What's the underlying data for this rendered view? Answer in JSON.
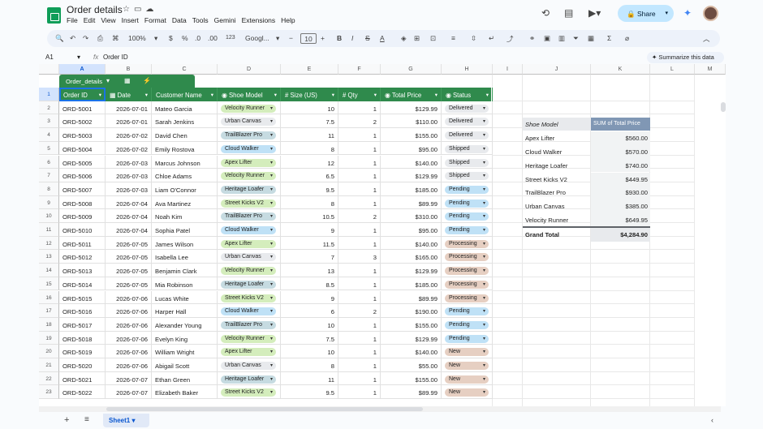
{
  "app": {
    "title": "Order details",
    "menu": [
      "File",
      "Edit",
      "View",
      "Insert",
      "Format",
      "Data",
      "Tools",
      "Gemini",
      "Extensions",
      "Help"
    ],
    "share_label": "Share"
  },
  "toolbar": {
    "zoom": "100%",
    "currency": "$",
    "percent": "%",
    "dec_decrease": ".0",
    "dec_increase": ".00",
    "number_format": "123",
    "font": "Googl...",
    "font_size": "10"
  },
  "formula_bar": {
    "name_box": "A1",
    "fx": "fx",
    "value": "Order ID",
    "summarize": "Summarize this data"
  },
  "columns": [
    "A",
    "B",
    "C",
    "D",
    "E",
    "F",
    "G",
    "H",
    "I",
    "J",
    "K",
    "L",
    "M"
  ],
  "table": {
    "name": "Order_details",
    "headers": [
      "Order ID",
      "Date",
      "Customer Name",
      "Shoe Model",
      "Size (US)",
      "Qty",
      "Total Price",
      "Status"
    ],
    "rows": [
      [
        "ORD-5001",
        "2026-07-01",
        "Mateo Garcia",
        "Velocity Runner",
        "10",
        "1",
        "$129.99",
        "Delivered"
      ],
      [
        "ORD-5002",
        "2026-07-01",
        "Sarah Jenkins",
        "Urban Canvas",
        "7.5",
        "2",
        "$110.00",
        "Delivered"
      ],
      [
        "ORD-5003",
        "2026-07-02",
        "David Chen",
        "TrailBlazer Pro",
        "11",
        "1",
        "$155.00",
        "Delivered"
      ],
      [
        "ORD-5004",
        "2026-07-02",
        "Emily Rostova",
        "Cloud Walker",
        "8",
        "1",
        "$95.00",
        "Shipped"
      ],
      [
        "ORD-5005",
        "2026-07-03",
        "Marcus Johnson",
        "Apex Lifter",
        "12",
        "1",
        "$140.00",
        "Shipped"
      ],
      [
        "ORD-5006",
        "2026-07-03",
        "Chloe Adams",
        "Velocity Runner",
        "6.5",
        "1",
        "$129.99",
        "Shipped"
      ],
      [
        "ORD-5007",
        "2026-07-03",
        "Liam O'Connor",
        "Heritage Loafer",
        "9.5",
        "1",
        "$185.00",
        "Pending"
      ],
      [
        "ORD-5008",
        "2026-07-04",
        "Ava Martinez",
        "Street Kicks V2",
        "8",
        "1",
        "$89.99",
        "Pending"
      ],
      [
        "ORD-5009",
        "2026-07-04",
        "Noah Kim",
        "TrailBlazer Pro",
        "10.5",
        "2",
        "$310.00",
        "Pending"
      ],
      [
        "ORD-5010",
        "2026-07-04",
        "Sophia Patel",
        "Cloud Walker",
        "9",
        "1",
        "$95.00",
        "Pending"
      ],
      [
        "ORD-5011",
        "2026-07-05",
        "James Wilson",
        "Apex Lifter",
        "11.5",
        "1",
        "$140.00",
        "Processing"
      ],
      [
        "ORD-5012",
        "2026-07-05",
        "Isabella Lee",
        "Urban Canvas",
        "7",
        "3",
        "$165.00",
        "Processing"
      ],
      [
        "ORD-5013",
        "2026-07-05",
        "Benjamin Clark",
        "Velocity Runner",
        "13",
        "1",
        "$129.99",
        "Processing"
      ],
      [
        "ORD-5014",
        "2026-07-05",
        "Mia Robinson",
        "Heritage Loafer",
        "8.5",
        "1",
        "$185.00",
        "Processing"
      ],
      [
        "ORD-5015",
        "2026-07-06",
        "Lucas White",
        "Street Kicks V2",
        "9",
        "1",
        "$89.99",
        "Processing"
      ],
      [
        "ORD-5016",
        "2026-07-06",
        "Harper Hall",
        "Cloud Walker",
        "6",
        "2",
        "$190.00",
        "Pending"
      ],
      [
        "ORD-5017",
        "2026-07-06",
        "Alexander Young",
        "TrailBlazer Pro",
        "10",
        "1",
        "$155.00",
        "Pending"
      ],
      [
        "ORD-5018",
        "2026-07-06",
        "Evelyn King",
        "Velocity Runner",
        "7.5",
        "1",
        "$129.99",
        "Pending"
      ],
      [
        "ORD-5019",
        "2026-07-06",
        "William Wright",
        "Apex Lifter",
        "10",
        "1",
        "$140.00",
        "New"
      ],
      [
        "ORD-5020",
        "2026-07-06",
        "Abigail Scott",
        "Urban Canvas",
        "8",
        "1",
        "$55.00",
        "New"
      ],
      [
        "ORD-5021",
        "2026-07-07",
        "Ethan Green",
        "Heritage Loafer",
        "11",
        "1",
        "$155.00",
        "New"
      ],
      [
        "ORD-5022",
        "2026-07-07",
        "Elizabeth Baker",
        "Street Kicks V2",
        "9.5",
        "1",
        "$89.99",
        "New"
      ]
    ]
  },
  "row_numbers": [
    "1",
    "2",
    "3",
    "4",
    "5",
    "6",
    "7",
    "8",
    "9",
    "10",
    "11",
    "12",
    "13",
    "14",
    "15",
    "16",
    "17",
    "18",
    "19",
    "20",
    "21",
    "22",
    "23"
  ],
  "model_colors": {
    "Velocity Runner": "#d4edbc",
    "Urban Canvas": "#e8eaed",
    "TrailBlazer Pro": "#c6dbe1",
    "Cloud Walker": "#bfe1f6",
    "Apex Lifter": "#d4edbc",
    "Heritage Loafer": "#c6dbe1",
    "Street Kicks V2": "#d4edbc"
  },
  "status_colors": {
    "Delivered": "#e8eaed",
    "Shipped": "#e8eaed",
    "Pending": "#bfe1f6",
    "Processing": "#e6cfc2",
    "New": "#e6cfc2"
  },
  "pivot": {
    "header_model": "Shoe Model",
    "header_sum": "SUM of Total Price",
    "rows": [
      [
        "Apex Lifter",
        "$560.00"
      ],
      [
        "Cloud Walker",
        "$570.00"
      ],
      [
        "Heritage Loafer",
        "$740.00"
      ],
      [
        "Street Kicks V2",
        "$449.95"
      ],
      [
        "TrailBlazer Pro",
        "$930.00"
      ],
      [
        "Urban Canvas",
        "$385.00"
      ],
      [
        "Velocity Runner",
        "$649.95"
      ]
    ],
    "total_label": "Grand Total",
    "total_value": "$4,284.90"
  },
  "sheet_tab": "Sheet1"
}
